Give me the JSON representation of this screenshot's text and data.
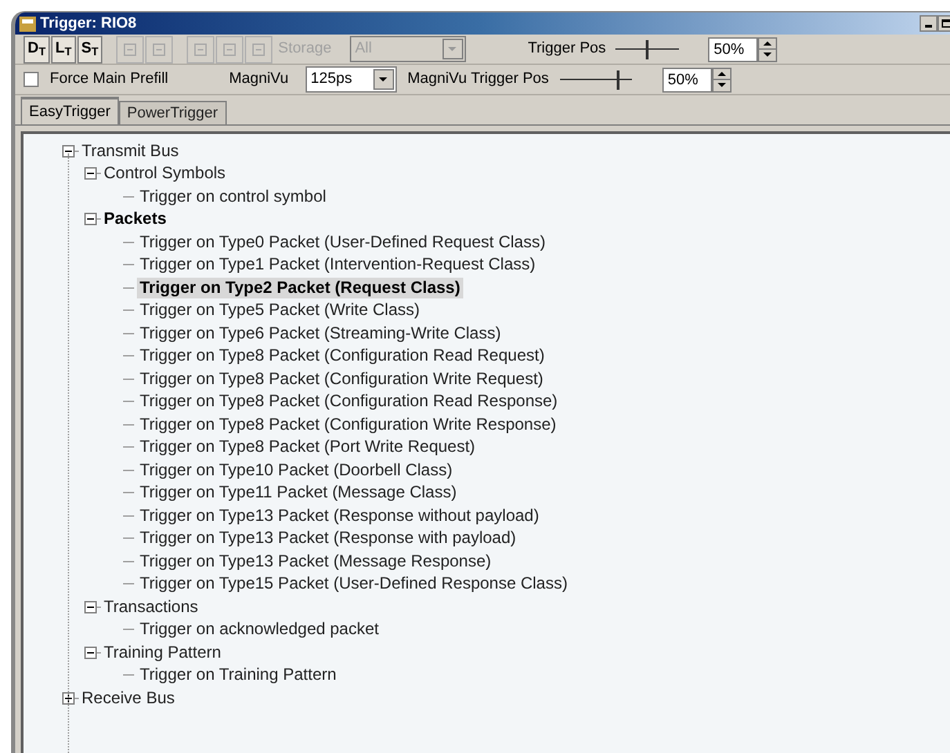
{
  "window": {
    "title": "Trigger: RIO8"
  },
  "toolbar": {
    "mode_buttons": [
      {
        "label": "D$_{T}$",
        "disabled": false
      },
      {
        "label": "L$_{T}$",
        "disabled": false
      },
      {
        "label": "S$_{T}$",
        "disabled": false
      }
    ],
    "storage": {
      "label": "Storage",
      "value": "All",
      "disabled": true
    },
    "trigger_pos": {
      "label": "Trigger Pos",
      "level": 0.5,
      "value": "50%"
    }
  },
  "options": {
    "force_main_prefill": {
      "label": "Force Main Prefill",
      "checked": false
    },
    "magnivu": {
      "label": "MagniVu",
      "value": "125ps"
    },
    "magnivu_trigger_pos": {
      "label": "MagniVu Trigger Pos",
      "level": 0.8,
      "value": "50%"
    }
  },
  "tabs": [
    {
      "label": "EasyTrigger",
      "selected": true
    },
    {
      "label": "PowerTrigger",
      "selected": false
    }
  ],
  "tree": [
    {
      "label": "Transmit Bus",
      "expanded": true,
      "bold": false,
      "selected": false,
      "children": [
        {
          "label": "Control Symbols",
          "expanded": true,
          "bold": false,
          "selected": false,
          "children": [
            {
              "label": "Trigger on control symbol",
              "bold": false,
              "selected": false
            }
          ]
        },
        {
          "label": "Packets",
          "expanded": true,
          "bold": true,
          "selected": false,
          "children": [
            {
              "label": "Trigger on Type0 Packet (User-Defined Request Class)",
              "bold": false,
              "selected": false
            },
            {
              "label": "Trigger on Type1 Packet (Intervention-Request Class)",
              "bold": false,
              "selected": false
            },
            {
              "label": "Trigger on Type2 Packet (Request Class)",
              "bold": true,
              "selected": true
            },
            {
              "label": "Trigger on Type5 Packet (Write Class)",
              "bold": false,
              "selected": false
            },
            {
              "label": "Trigger on Type6 Packet (Streaming-Write Class)",
              "bold": false,
              "selected": false
            },
            {
              "label": "Trigger on Type8 Packet (Configuration Read Request)",
              "bold": false,
              "selected": false
            },
            {
              "label": "Trigger on Type8 Packet (Configuration Write Request)",
              "bold": false,
              "selected": false
            },
            {
              "label": "Trigger on Type8 Packet (Configuration Read Response)",
              "bold": false,
              "selected": false
            },
            {
              "label": "Trigger on Type8 Packet (Configuration Write Response)",
              "bold": false,
              "selected": false
            },
            {
              "label": "Trigger on Type8 Packet (Port Write Request)",
              "bold": false,
              "selected": false
            },
            {
              "label": "Trigger on Type10 Packet (Doorbell Class)",
              "bold": false,
              "selected": false
            },
            {
              "label": "Trigger on Type11 Packet (Message Class)",
              "bold": false,
              "selected": false
            },
            {
              "label": "Trigger on Type13 Packet (Response without payload)",
              "bold": false,
              "selected": false
            },
            {
              "label": "Trigger on Type13 Packet (Response with payload)",
              "bold": false,
              "selected": false
            },
            {
              "label": "Trigger on Type13 Packet (Message Response)",
              "bold": false,
              "selected": false
            },
            {
              "label": "Trigger on Type15 Packet (User-Defined Response Class)",
              "bold": false,
              "selected": false
            }
          ]
        },
        {
          "label": "Transactions",
          "expanded": true,
          "bold": false,
          "selected": false,
          "children": [
            {
              "label": "Trigger on acknowledged packet",
              "bold": false,
              "selected": false
            }
          ]
        },
        {
          "label": "Training Pattern",
          "expanded": true,
          "bold": false,
          "selected": false,
          "children": [
            {
              "label": "Trigger on Training Pattern",
              "bold": false,
              "selected": false
            }
          ]
        }
      ]
    },
    {
      "label": "Receive Bus",
      "expanded": false,
      "bold": false,
      "selected": false
    }
  ]
}
